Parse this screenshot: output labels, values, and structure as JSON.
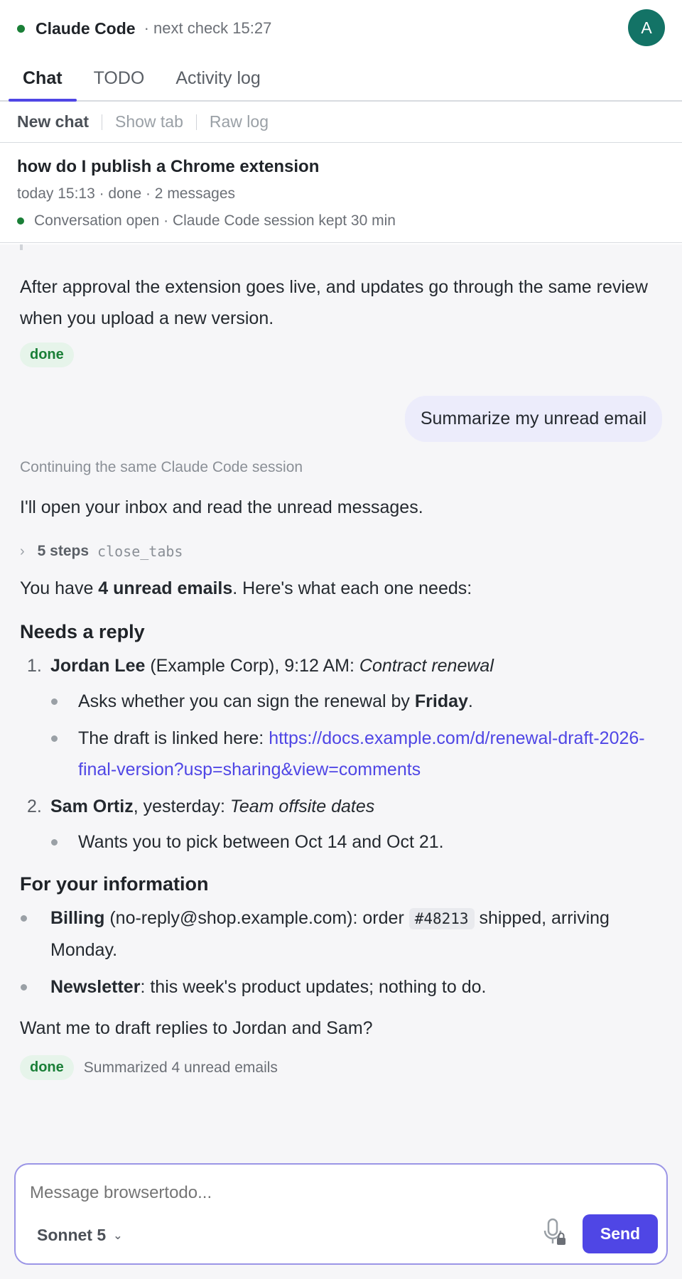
{
  "header": {
    "app_title": "Claude Code",
    "next_check": "· next check 15:27",
    "avatar_initial": "A",
    "status_color": "#1a7f37"
  },
  "tabs": [
    {
      "label": "Chat",
      "active": true
    },
    {
      "label": "TODO",
      "active": false
    },
    {
      "label": "Activity log",
      "active": false
    }
  ],
  "subbar": {
    "new_chat": "New chat",
    "show_tab": "Show tab",
    "raw_log": "Raw log"
  },
  "conversation": {
    "title": "how do I publish a Chrome extension",
    "meta": "today 15:13 · done · 2 messages",
    "status": "Conversation open · Claude Code session kept 30 min"
  },
  "chat": {
    "prev_reply_tail": "After approval the extension goes live, and updates go through the same review when you upload a new version.",
    "done_badge": "done",
    "user_message": "Summarize my unread email",
    "continuing_note": "Continuing the same Claude Code session",
    "intro": "I'll open your inbox and read the unread messages.",
    "steps": {
      "count": "5 steps",
      "tool": "close_tabs"
    },
    "summary_line": {
      "pre": "You have ",
      "bold": "4 unread emails",
      "post": ". Here's what each one needs:"
    },
    "needs_reply_heading": "Needs a reply",
    "reply_items": [
      {
        "num": "1.",
        "sender": "Jordan Lee",
        "detail": " (Example Corp), 9:12 AM: ",
        "subject": "Contract renewal",
        "bullets": [
          {
            "pre": "Asks whether you can sign the renewal by ",
            "bold": "Friday",
            "post": "."
          },
          {
            "pre": "The draft is linked here: ",
            "link": "https://docs.example.com/d/renewal-draft-2026-final-version?usp=sharing&view=comments"
          }
        ]
      },
      {
        "num": "2.",
        "sender": "Sam Ortiz",
        "detail": ", yesterday: ",
        "subject": "Team offsite dates",
        "bullets": [
          {
            "pre": "Wants you to pick between Oct 14 and Oct 21."
          }
        ]
      }
    ],
    "fyi_heading": "For your information",
    "fyi_items": [
      {
        "bold": "Billing",
        "pre": " (no-reply@shop.example.com): order ",
        "code": "#48213",
        "post": " shipped, arriving Monday."
      },
      {
        "bold": "Newsletter",
        "pre": ": this week's product updates; nothing to do."
      }
    ],
    "closing_question": "Want me to draft replies to Jordan and Sam?",
    "final_badge": "done",
    "final_summary": "Summarized 4 unread emails"
  },
  "composer": {
    "placeholder": "Message browsertodo...",
    "model": "Sonnet 5",
    "send_label": "Send"
  },
  "colors": {
    "accent": "#4f46e5",
    "success": "#1a7f37",
    "avatar": "#137366"
  }
}
